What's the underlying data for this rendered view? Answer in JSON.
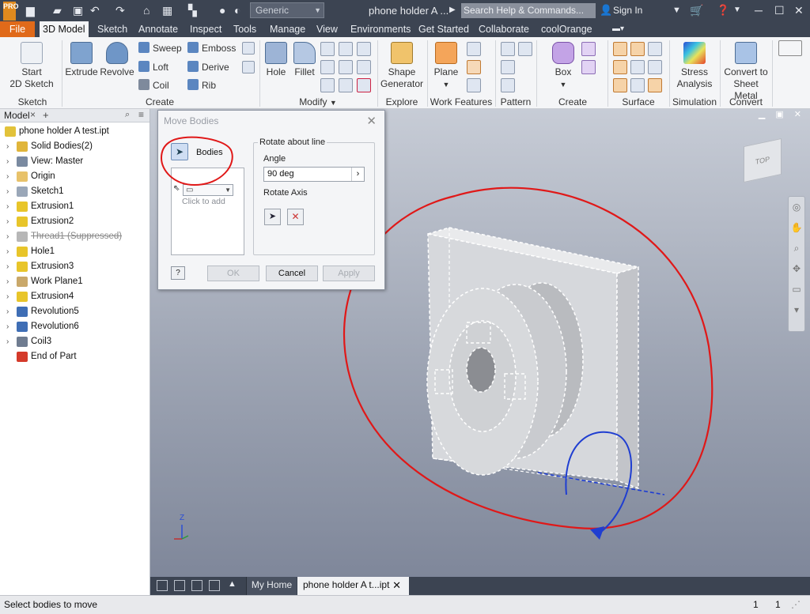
{
  "app": {
    "logo_text": "PRO",
    "doc_title": "phone holder A ...",
    "profile": "Generic",
    "search_placeholder": "Search Help & Commands...",
    "signin": "Sign In"
  },
  "tabs": [
    "File",
    "3D Model",
    "Sketch",
    "Annotate",
    "Inspect",
    "Tools",
    "Manage",
    "View",
    "Environments",
    "Get Started",
    "Collaborate",
    "coolOrange"
  ],
  "ribbon": {
    "sketch": {
      "start": "Start",
      "start2": "2D Sketch",
      "group": "Sketch"
    },
    "create": {
      "extrude": "Extrude",
      "revolve": "Revolve",
      "sweep": "Sweep",
      "loft": "Loft",
      "coil": "Coil",
      "emboss": "Emboss",
      "derive": "Derive",
      "rib": "Rib",
      "group": "Create"
    },
    "modify": {
      "hole": "Hole",
      "fillet": "Fillet",
      "group": "Modify"
    },
    "explore": {
      "shape1": "Shape",
      "shape2": "Generator",
      "group": "Explore"
    },
    "work": {
      "plane": "Plane",
      "group": "Work Features"
    },
    "pattern": {
      "group": "Pattern"
    },
    "freeform": {
      "box": "Box",
      "group": "Create Freeform"
    },
    "surface": {
      "group": "Surface"
    },
    "simulation": {
      "stress1": "Stress",
      "stress2": "Analysis",
      "group": "Simulation"
    },
    "convert": {
      "c1": "Convert to",
      "c2": "Sheet Metal",
      "group": "Convert"
    }
  },
  "browser": {
    "tab": "Model",
    "nodes": [
      {
        "label": "phone holder A test.ipt",
        "icon": "part-icon",
        "color": "#e2c23a"
      },
      {
        "label": "Solid Bodies(2)",
        "icon": "solid-bodies-icon",
        "color": "#e0b53a"
      },
      {
        "label": "View: Master",
        "icon": "view-icon",
        "color": "#7a8aa0"
      },
      {
        "label": "Origin",
        "icon": "folder-icon",
        "color": "#e8c26a"
      },
      {
        "label": "Sketch1",
        "icon": "sketch-icon",
        "color": "#9aa7b8"
      },
      {
        "label": "Extrusion1",
        "icon": "extrusion-icon",
        "color": "#e8c52a"
      },
      {
        "label": "Extrusion2",
        "icon": "extrusion-icon",
        "color": "#e8c52a"
      },
      {
        "label": "Thread1 (Suppressed)",
        "icon": "thread-icon",
        "color": "#b7b7b7"
      },
      {
        "label": "Hole1",
        "icon": "hole-icon",
        "color": "#e8c52a"
      },
      {
        "label": "Extrusion3",
        "icon": "extrusion-icon",
        "color": "#e8c52a"
      },
      {
        "label": "Work Plane1",
        "icon": "work-plane-icon",
        "color": "#c9a86a"
      },
      {
        "label": "Extrusion4",
        "icon": "extrusion-icon",
        "color": "#e8c52a"
      },
      {
        "label": "Revolution5",
        "icon": "revolution-icon",
        "color": "#3f6eb5"
      },
      {
        "label": "Revolution6",
        "icon": "revolution-icon",
        "color": "#3f6eb5"
      },
      {
        "label": "Coil3",
        "icon": "coil-icon",
        "color": "#6f7c90"
      },
      {
        "label": "End of Part",
        "icon": "end-of-part-icon",
        "color": "#d43a2a"
      }
    ]
  },
  "dialog": {
    "title": "Move Bodies",
    "bodies_label": "Bodies",
    "click_to_add": "Click to add",
    "rotate_title": "Rotate about line",
    "angle_label": "Angle",
    "angle_value": "90 deg",
    "rotate_axis_label": "Rotate Axis",
    "ok": "OK",
    "cancel": "Cancel",
    "apply": "Apply",
    "help": "?"
  },
  "viewport": {
    "viewcube_face": "TOP",
    "triad_z": "Z"
  },
  "doc_tabs": {
    "home": "My Home",
    "active": "phone holder A t...ipt"
  },
  "status": {
    "message": "Select bodies to move",
    "count1": "1",
    "count2": "1"
  },
  "colors": {
    "accent_file": "#e06a1a",
    "annotation_red": "#e01818",
    "annotation_blue": "#1f3ed1"
  }
}
